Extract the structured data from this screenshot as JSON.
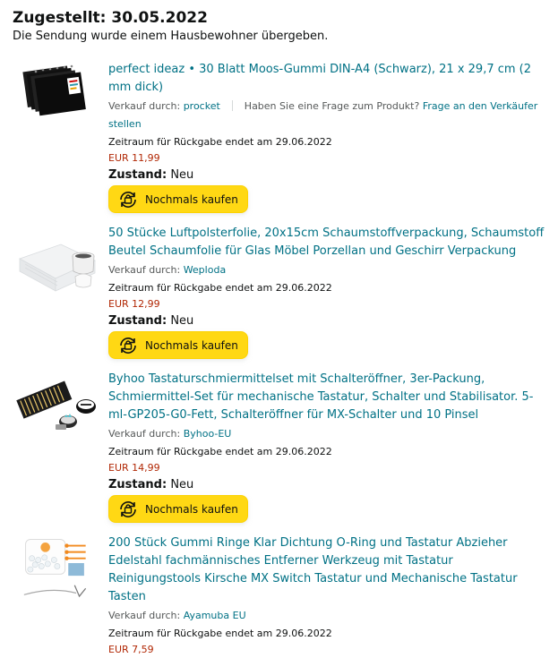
{
  "header": {
    "title": "Zugestellt: 30.05.2022",
    "subtitle": "Die Sendung wurde einem Hausbewohner übergeben."
  },
  "labels": {
    "sold_by": "Verkauf durch:",
    "question": "Haben Sie eine Frage zum Produkt?",
    "ask_seller": "Frage an den Verkäufer stellen",
    "condition": "Zustand:",
    "buy_again": "Nochmals kaufen"
  },
  "items": [
    {
      "title": "perfect ideaz • 30 Blatt Moos-Gummi DIN-A4 (Schwarz), 21 x 29,7 cm (2 mm dick)",
      "seller": "procket",
      "return_text": "Zeitraum für Rückgabe endet am 29.06.2022",
      "price": "EUR 11,99",
      "condition": "Neu"
    },
    {
      "title": "50 Stücke Luftpolsterfolie, 20x15cm Schaumstoffverpackung, Schaumstoff Beutel Schaumfolie für Glas Möbel Porzellan und Geschirr Verpackung",
      "seller": "Weploda",
      "return_text": "Zeitraum für Rückgabe endet am 29.06.2022",
      "price": "EUR 12,99",
      "condition": "Neu"
    },
    {
      "title": "Byhoo Tastaturschmiermittelset mit Schalteröffner, 3er-Packung, Schmiermittel-Set für mechanische Tastatur, Schalter und Stabilisator. 5-ml-GP205-G0-Fett, Schalteröffner für MX-Schalter und 10 Pinsel",
      "seller": "Byhoo-EU",
      "return_text": "Zeitraum für Rückgabe endet am 29.06.2022",
      "price": "EUR 14,99",
      "condition": "Neu"
    },
    {
      "title": "200 Stück Gummi Ringe Klar Dichtung O-Ring und Tastatur Abzieher Edelstahl fachmännisches Entferner Werkzeug mit Tastatur Reinigungstools Kirsche MX Switch Tastatur und Mechanische Tastatur Tasten",
      "seller": "Ayamuba EU",
      "return_text": "Zeitraum für Rückgabe endet am 29.06.2022",
      "price": "EUR 7,59"
    }
  ]
}
